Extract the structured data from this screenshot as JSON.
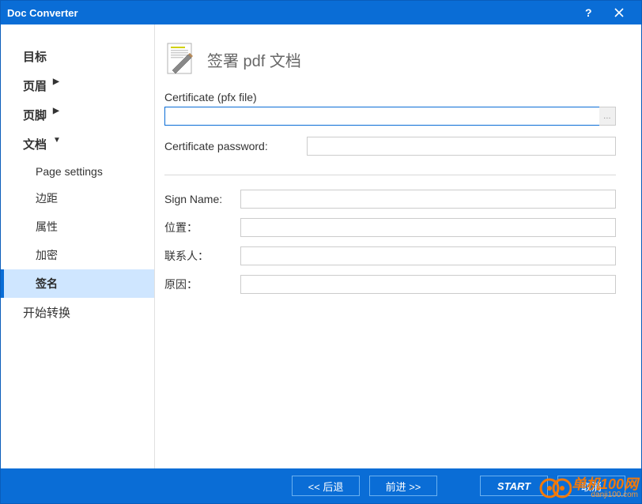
{
  "titlebar": {
    "title": "Doc Converter"
  },
  "sidebar": {
    "items": [
      {
        "label": "目标",
        "expandable": false
      },
      {
        "label": "页眉",
        "expandable": true
      },
      {
        "label": "页脚",
        "expandable": true
      },
      {
        "label": "文档",
        "expandable": true
      },
      {
        "label": "Page settings"
      },
      {
        "label": "边距"
      },
      {
        "label": "属性"
      },
      {
        "label": "加密"
      },
      {
        "label": "签名"
      },
      {
        "label": "开始转换",
        "expandable": false
      }
    ]
  },
  "page": {
    "title": "签署 pdf 文档",
    "cert_label": "Certificate (pfx file)",
    "cert_value": "",
    "cert_pw_label": "Certificate password:",
    "cert_pw_value": "",
    "sign_name_label": "Sign Name:",
    "sign_name_value": "",
    "location_label": "位置：",
    "location_value": "",
    "contact_label": "联系人：",
    "contact_value": "",
    "reason_label": "原因：",
    "reason_value": ""
  },
  "footer": {
    "back": "<<  后退",
    "forward": "前进  >>",
    "start": "START",
    "cancel": "取消"
  },
  "watermark": {
    "text": "单机100网",
    "sub": "danji100.com"
  }
}
